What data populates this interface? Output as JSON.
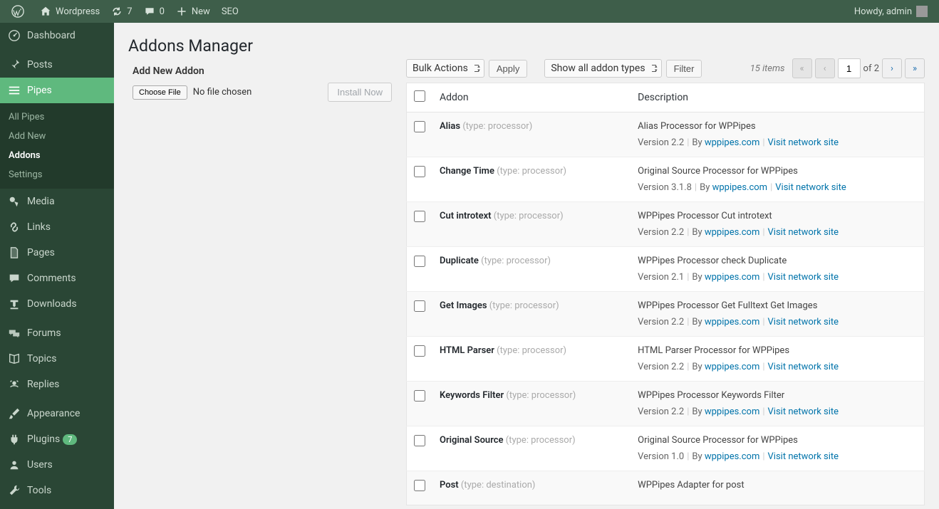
{
  "adminbar": {
    "site_name": "Wordpress",
    "updates_count": "7",
    "comments_count": "0",
    "new_label": "New",
    "seo_label": "SEO",
    "howdy": "Howdy, admin"
  },
  "sidebar": {
    "dashboard": "Dashboard",
    "posts": "Posts",
    "pipes": "Pipes",
    "pipes_sub": {
      "all_pipes": "All Pipes",
      "add_new": "Add New",
      "addons": "Addons",
      "settings": "Settings"
    },
    "media": "Media",
    "links": "Links",
    "pages": "Pages",
    "comments": "Comments",
    "downloads": "Downloads",
    "forums": "Forums",
    "topics": "Topics",
    "replies": "Replies",
    "appearance": "Appearance",
    "plugins": "Plugins",
    "plugins_badge": "7",
    "users": "Users",
    "tools": "Tools"
  },
  "page": {
    "title": "Addons Manager",
    "add_new_heading": "Add New Addon",
    "choose_file": "Choose File",
    "no_file": "No file chosen",
    "install_now": "Install Now",
    "bulk_actions": "Bulk Actions",
    "apply": "Apply",
    "show_all_types": "Show all addon types",
    "filter": "Filter",
    "items_count": "15 items",
    "page_current": "1",
    "page_of": "of 2",
    "col_addon": "Addon",
    "col_description": "Description"
  },
  "rows": [
    {
      "name": "Alias",
      "type": "(type: processor)",
      "desc": "Alias Processor for WPPipes",
      "version": "Version 2.2",
      "by": "By",
      "author": "wppipes.com",
      "link": "Visit network site"
    },
    {
      "name": "Change Time",
      "type": "(type: processor)",
      "desc": "Original Source Processor for WPPipes",
      "version": "Version 3.1.8",
      "by": "By",
      "author": "wppipes.com",
      "link": "Visit network site"
    },
    {
      "name": "Cut introtext",
      "type": "(type: processor)",
      "desc": "WPPipes Processor Cut introtext",
      "version": "Version 2.2",
      "by": "By",
      "author": "wppipes.com",
      "link": "Visit network site"
    },
    {
      "name": "Duplicate",
      "type": "(type: processor)",
      "desc": "WPPipes Processor check Duplicate",
      "version": "Version 2.1",
      "by": "By",
      "author": "wppipes.com",
      "link": "Visit network site"
    },
    {
      "name": "Get Images",
      "type": "(type: processor)",
      "desc": "WPPipes Processor Get Fulltext Get Images",
      "version": "Version 2.2",
      "by": "By",
      "author": "wppipes.com",
      "link": "Visit network site"
    },
    {
      "name": "HTML Parser",
      "type": "(type: processor)",
      "desc": "HTML Parser Processor for WPPipes",
      "version": "Version 2.2",
      "by": "By",
      "author": "wppipes.com",
      "link": "Visit network site"
    },
    {
      "name": "Keywords Filter",
      "type": "(type: processor)",
      "desc": "WPPipes Processor Keywords Filter",
      "version": "Version 2.2",
      "by": "By",
      "author": "wppipes.com",
      "link": "Visit network site"
    },
    {
      "name": "Original Source",
      "type": "(type: processor)",
      "desc": "Original Source Processor for WPPipes",
      "version": "Version 1.0",
      "by": "By",
      "author": "wppipes.com",
      "link": "Visit network site"
    },
    {
      "name": "Post",
      "type": "(type: destination)",
      "desc": "WPPipes Adapter for post",
      "version": "",
      "by": "",
      "author": "",
      "link": ""
    }
  ]
}
